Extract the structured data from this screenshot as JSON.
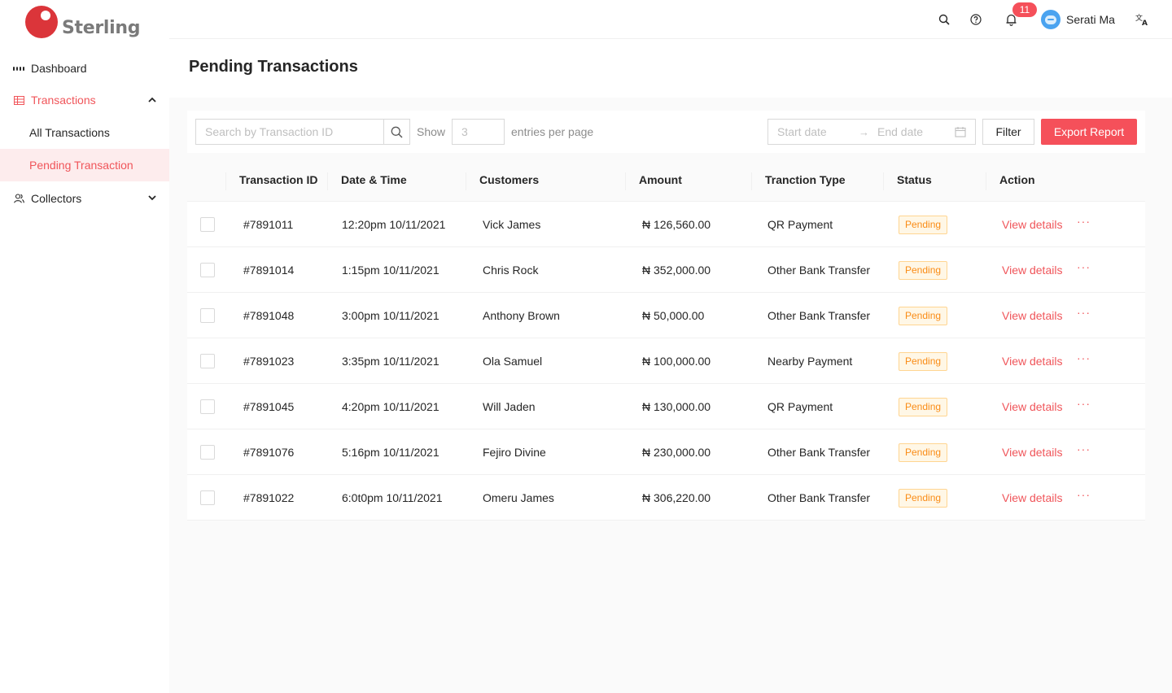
{
  "brand": {
    "name": "Sterling",
    "color": "#db353a"
  },
  "sidebar": {
    "items": [
      {
        "label": "Dashboard",
        "icon": "dashboard-icon"
      },
      {
        "label": "Transactions",
        "icon": "table-icon",
        "expanded": true,
        "children": [
          {
            "label": "All Transactions"
          },
          {
            "label": "Pending Transaction",
            "selected": true
          }
        ]
      },
      {
        "label": "Collectors",
        "icon": "users-icon",
        "expanded": false
      }
    ]
  },
  "header": {
    "notification_count": "11",
    "user_name": "Serati Ma",
    "icons": [
      "search-icon",
      "help-icon",
      "bell-icon",
      "translate-icon"
    ]
  },
  "page": {
    "title": "Pending Transactions"
  },
  "toolbar": {
    "search_placeholder": "Search by Transaction ID",
    "show_label": "Show",
    "entries_placeholder": "3",
    "entries_label": "entries per page",
    "start_date_placeholder": "Start date",
    "end_date_placeholder": "End date",
    "filter_label": "Filter",
    "export_label": "Export Report"
  },
  "table": {
    "columns": [
      "Transaction ID",
      "Date & Time",
      "Customers",
      "Amount",
      "Tranction Type",
      "Status",
      "Action"
    ],
    "rows": [
      {
        "id": "#7891011",
        "datetime": "12:20pm 10/11/2021",
        "customer": "Vick James",
        "amount": "₦ 126,560.00",
        "type": "QR Payment",
        "status": "Pending",
        "action": "View details"
      },
      {
        "id": "#7891014",
        "datetime": "1:15pm 10/11/2021",
        "customer": "Chris Rock",
        "amount": "₦ 352,000.00",
        "type": "Other Bank Transfer",
        "status": "Pending",
        "action": "View details"
      },
      {
        "id": "#7891048",
        "datetime": "3:00pm 10/11/2021",
        "customer": "Anthony Brown",
        "amount": "₦ 50,000.00",
        "type": "Other Bank Transfer",
        "status": "Pending",
        "action": "View details"
      },
      {
        "id": "#7891023",
        "datetime": "3:35pm 10/11/2021",
        "customer": "Ola Samuel",
        "amount": "₦ 100,000.00",
        "type": "Nearby Payment",
        "status": "Pending",
        "action": "View details"
      },
      {
        "id": "#7891045",
        "datetime": "4:20pm 10/11/2021",
        "customer": "Will Jaden",
        "amount": "₦ 130,000.00",
        "type": "QR Payment",
        "status": "Pending",
        "action": "View details"
      },
      {
        "id": "#7891076",
        "datetime": "5:16pm 10/11/2021",
        "customer": "Fejiro Divine",
        "amount": "₦ 230,000.00",
        "type": "Other Bank Transfer",
        "status": "Pending",
        "action": "View details"
      },
      {
        "id": "#7891022",
        "datetime": "6:0t0pm 10/11/2021",
        "customer": "Omeru James",
        "amount": "₦ 306,220.00",
        "type": "Other Bank Transfer",
        "status": "Pending",
        "action": "View details"
      }
    ]
  },
  "colors": {
    "accent": "#f5505a",
    "pending_text": "#fa8c16",
    "pending_bg": "#fff7e6",
    "pending_border": "#ffd591"
  }
}
